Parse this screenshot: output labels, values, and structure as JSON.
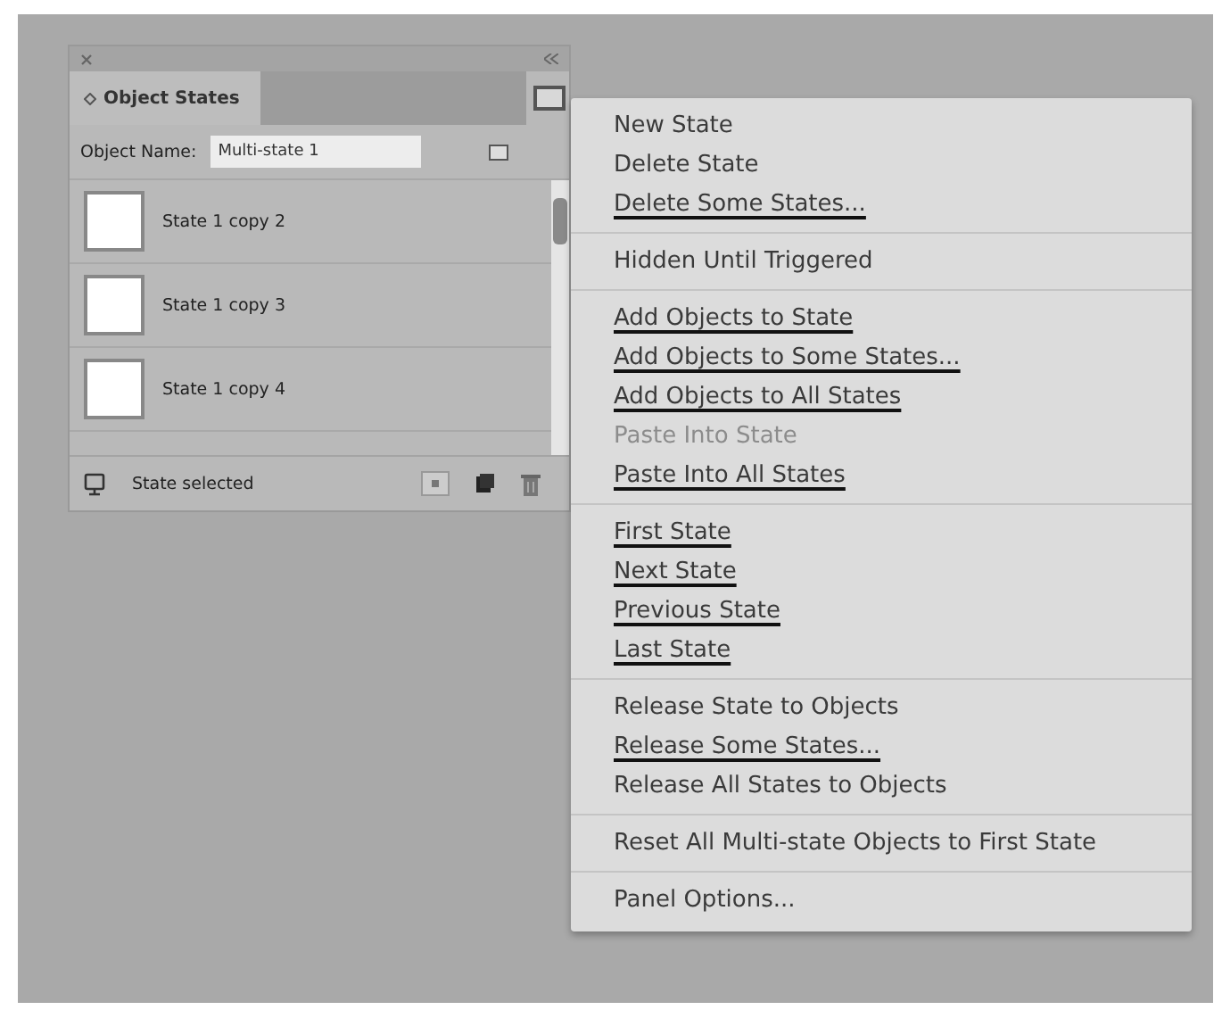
{
  "panel": {
    "tab": "Object States",
    "object_name_label": "Object Name:",
    "object_name": "Multi-state 1",
    "states": [
      {
        "name": "State 1 copy 2"
      },
      {
        "name": "State 1 copy 3"
      },
      {
        "name": "State 1 copy 4"
      }
    ],
    "status": "State selected"
  },
  "menu": {
    "groups": [
      [
        {
          "label": "New State",
          "disabled": false,
          "underlined": false
        },
        {
          "label": "Delete State",
          "disabled": false,
          "underlined": false
        },
        {
          "label": "Delete Some States...",
          "disabled": false,
          "underlined": true
        }
      ],
      [
        {
          "label": "Hidden Until Triggered",
          "disabled": false,
          "underlined": false
        }
      ],
      [
        {
          "label": "Add Objects to State",
          "disabled": false,
          "underlined": true
        },
        {
          "label": "Add Objects to Some States...",
          "disabled": false,
          "underlined": true
        },
        {
          "label": "Add Objects to All States",
          "disabled": false,
          "underlined": true
        },
        {
          "label": "Paste Into State",
          "disabled": true,
          "underlined": false
        },
        {
          "label": "Paste Into All States",
          "disabled": false,
          "underlined": true
        }
      ],
      [
        {
          "label": "First State",
          "disabled": false,
          "underlined": true
        },
        {
          "label": "Next State",
          "disabled": false,
          "underlined": true
        },
        {
          "label": "Previous State",
          "disabled": false,
          "underlined": true
        },
        {
          "label": "Last State",
          "disabled": false,
          "underlined": true
        }
      ],
      [
        {
          "label": "Release State to Objects",
          "disabled": false,
          "underlined": false
        },
        {
          "label": "Release Some States...",
          "disabled": false,
          "underlined": true
        },
        {
          "label": "Release All States to Objects",
          "disabled": false,
          "underlined": false
        }
      ],
      [
        {
          "label": "Reset All Multi-state Objects to First State",
          "disabled": false,
          "underlined": false
        }
      ],
      [
        {
          "label": "Panel Options...",
          "disabled": false,
          "underlined": false
        }
      ]
    ]
  }
}
